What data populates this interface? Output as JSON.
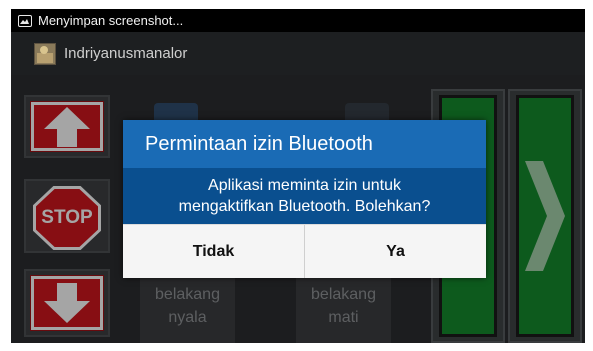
{
  "status_bar": {
    "icon": "image-icon",
    "text": "Menyimpan screenshot..."
  },
  "action_bar": {
    "app_icon": "app-icon",
    "title": "Indriyanusmanalor"
  },
  "controls": {
    "up_icon": "arrow-up-icon",
    "stop_label": "STOP",
    "down_icon": "arrow-down-icon",
    "lamp_on_label_line1": "belakang",
    "lamp_on_label_line2": "nyala",
    "lamp_off_label_line1": "belakang",
    "lamp_off_label_line2": "mati",
    "left_icon": "arrow-left-icon",
    "right_icon": "arrow-right-icon"
  },
  "dialog": {
    "title": "Permintaan izin Bluetooth",
    "message_line1": "Aplikasi meminta izin untuk",
    "message_line2": "mengaktifkan Bluetooth. Bolehkan?",
    "deny_label": "Tidak",
    "allow_label": "Ya"
  },
  "colors": {
    "dialog_title_bg": "#1a6bb5",
    "dialog_message_bg": "#0a4f8f",
    "sign_red": "#c8161c",
    "panel_green": "#14852c"
  }
}
